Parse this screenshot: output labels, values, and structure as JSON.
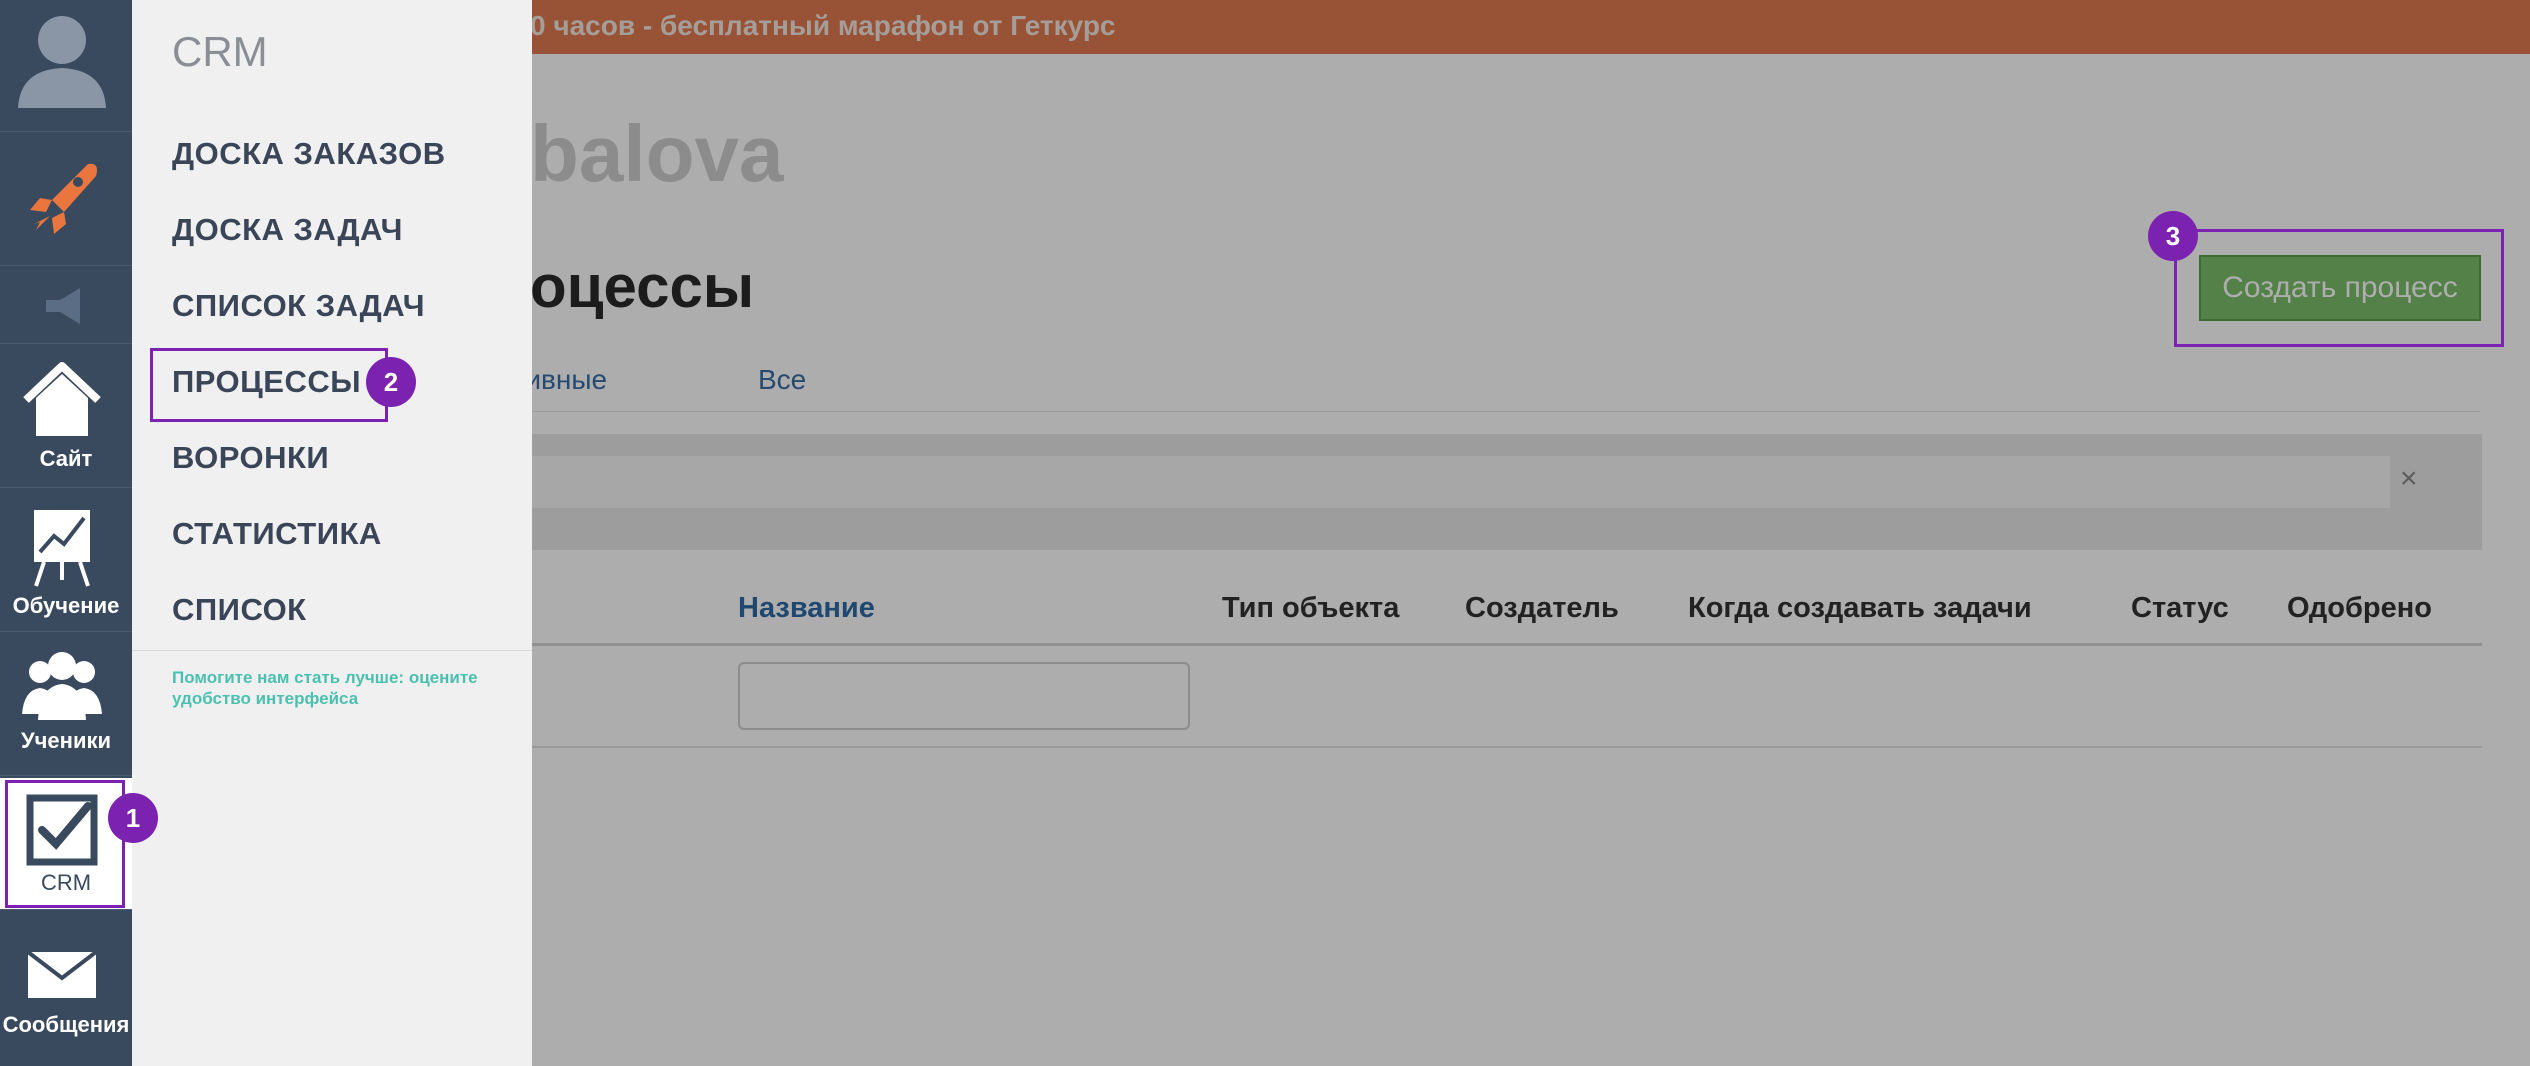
{
  "banner": {
    "text": "0 часов - бесплатный марафон от Геткурс"
  },
  "main": {
    "account_title": "balova",
    "page_title": "оцессы",
    "create_button": "Создать процесс",
    "tabs": [
      {
        "label": "ктивные"
      },
      {
        "label": "Все"
      }
    ],
    "clear_icon": "×",
    "table": {
      "columns": [
        "Название",
        "Тип объекта",
        "Создатель",
        "Когда создавать задачи",
        "Статус",
        "Одобрено"
      ]
    }
  },
  "sidebar": {
    "items": [
      {
        "name": "avatar",
        "label": ""
      },
      {
        "name": "rocket-icon",
        "label": ""
      },
      {
        "name": "megaphone-icon",
        "label": ""
      },
      {
        "name": "home-icon",
        "label": "Сайт"
      },
      {
        "name": "presentation-chart-icon",
        "label": "Обучение"
      },
      {
        "name": "users-icon",
        "label": "Ученики"
      },
      {
        "name": "checkbox-icon",
        "label": "CRM"
      },
      {
        "name": "envelope-icon",
        "label": "Сообщения"
      }
    ]
  },
  "crm_menu": {
    "title": "CRM",
    "items": [
      "ДОСКА ЗАКАЗОВ",
      "ДОСКА ЗАДАЧ",
      "СПИСОК ЗАДАЧ",
      "ПРОЦЕССЫ",
      "ВОРОНКИ",
      "СТАТИСТИКА",
      "СПИСОК"
    ],
    "feedback": "Помогите нам стать лучше: оцените удобство интерфейса"
  },
  "annotations": {
    "step1": "1",
    "step2": "2",
    "step3": "3"
  },
  "colors": {
    "highlight": "#7b22b0",
    "banner": "#e07a50",
    "sidebar": "#3a4a5e",
    "create_button": "#7bbf6a",
    "feedback_link": "#4cc0b0"
  }
}
